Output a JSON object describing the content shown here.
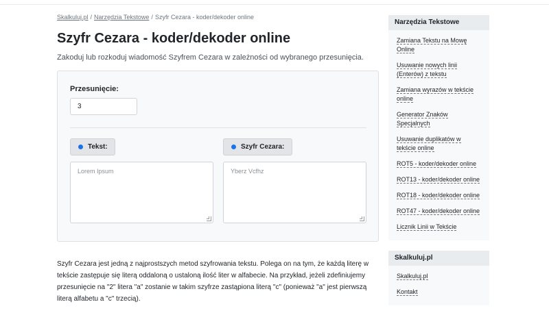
{
  "breadcrumb": {
    "home": "Skalkuluj.pl",
    "section": "Narzędzia Tekstowe",
    "current": "Szyfr Cezara - koder/dekoder online",
    "separator": "/"
  },
  "page": {
    "title": "Szyfr Cezara - koder/dekoder online",
    "subtitle": "Zakoduj lub rozkoduj wiadomość Szyfrem Cezara w zależności od wybranego przesunięcia."
  },
  "tool": {
    "shift_label": "Przesunięcie:",
    "shift_value": "3",
    "plain_label": "Tekst:",
    "plain_placeholder": "Lorem Ipsum",
    "cipher_label": "Szyfr Cezara:",
    "cipher_placeholder": "Yberz Vcfhz"
  },
  "description": "Szyfr Cezara jest jedną z najprostszych metod szyfrowania tekstu. Polega on na tym, że każdą literę w tekście zastępuje się literą oddaloną o ustaloną ilość liter w alfabecie. Na przykład, jeżeli zdefiniujemy przesunięcie na \"2\" litera \"a\" zostanie w takim szyfrze zastąpiona literą \"c\" (ponieważ \"a\" jest pierwszą literą alfabetu a \"c\" trzecią).",
  "sidebar": {
    "tools_title": "Narzędzia Tekstowe",
    "tools": [
      "Zamiana Tekstu na Mowę Online",
      "Usuwanie nowych linii (Enterów) z tekstu",
      "Zamiana wyrazów w tekście online",
      "Generator Znaków Specjalnych",
      "Usuwanie duplikatów w tekście online",
      "ROT5 - koder/dekoder online",
      "ROT13 - koder/dekoder online",
      "ROT18 - koder/dekoder online",
      "ROT47 - koder/dekoder online",
      "Licznik Linii w Tekście"
    ],
    "site_title": "Skalkuluj.pl",
    "site_links": [
      "Skalkuluj.pl",
      "Kontakt"
    ]
  },
  "colors": {
    "accent_dot": "#1a73e8",
    "card_bg": "#f8f9fa",
    "widget_head_bg": "#e9ecef"
  }
}
